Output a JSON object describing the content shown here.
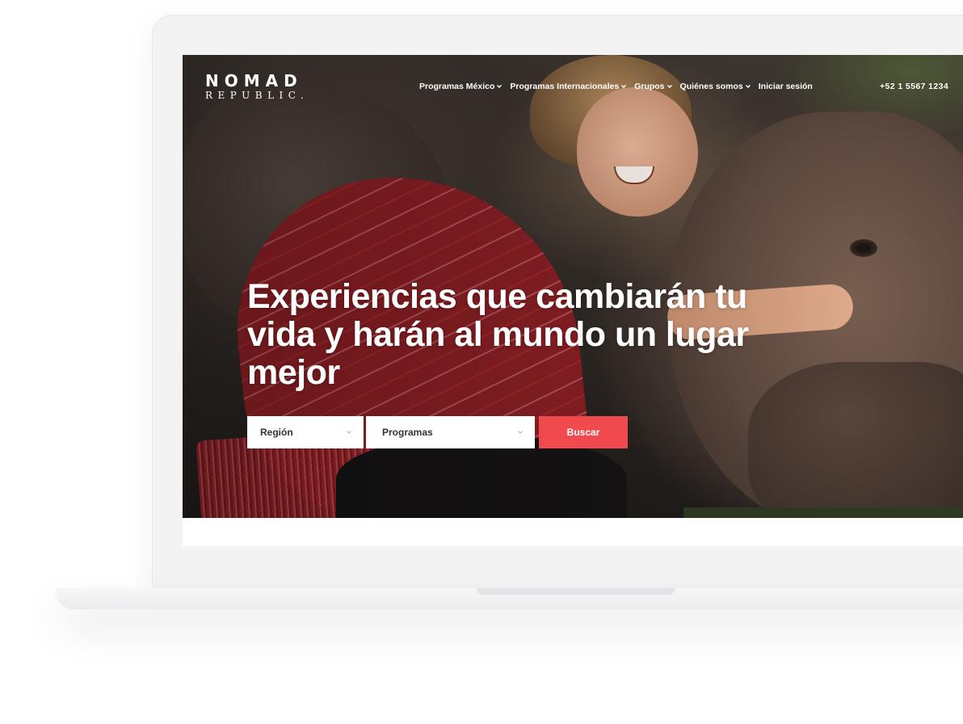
{
  "logo": {
    "line1": "NOMAD",
    "line2": "REPUBLIC."
  },
  "nav": {
    "items": [
      {
        "label": "Programas México"
      },
      {
        "label": "Programas Internacionales"
      },
      {
        "label": "Grupos"
      },
      {
        "label": "Quiénes somos"
      },
      {
        "label": "Iniciar sesión"
      }
    ],
    "phone": "+52 1 5567 1234"
  },
  "hero": {
    "headline": "Experiencias que cambiarán tu vida y harán al mundo un lugar mejor"
  },
  "search": {
    "region_value": "Región",
    "programs_value": "Programas",
    "button_label": "Buscar"
  },
  "colors": {
    "accent": "#f04a4f",
    "text_on_hero": "#ffffff"
  }
}
